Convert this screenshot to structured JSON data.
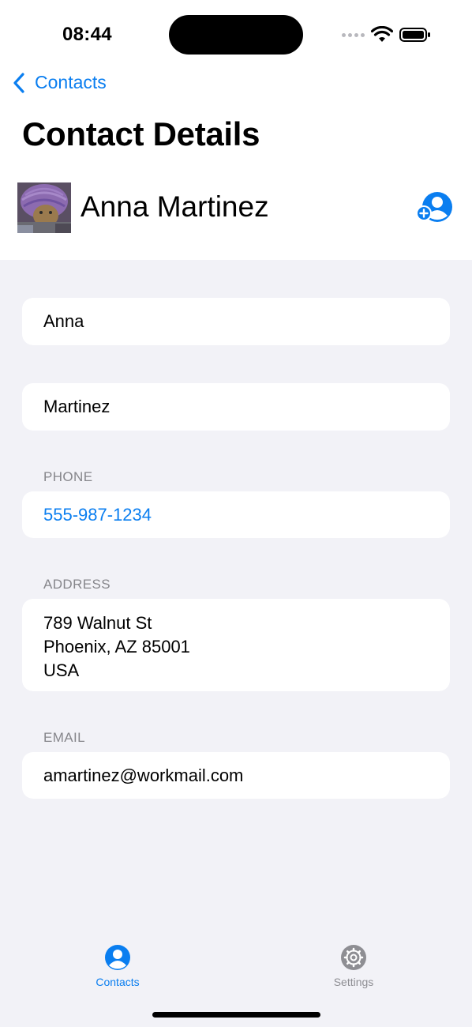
{
  "status_bar": {
    "time": "08:44"
  },
  "nav": {
    "back_label": "Contacts",
    "title": "Contact Details"
  },
  "contact": {
    "full_name": "Anna Martinez"
  },
  "fields": {
    "first_name": "Anna",
    "last_name": "Martinez",
    "phone_header": "PHONE",
    "phone": "555-987-1234",
    "address_header": "ADDRESS",
    "address_lines": [
      "789 Walnut St",
      "Phoenix, AZ 85001",
      "USA"
    ],
    "email_header": "EMAIL",
    "email": "amartinez@workmail.com"
  },
  "tab_bar": {
    "tabs": [
      {
        "label": "Contacts",
        "icon": "person-circle-icon",
        "active": true
      },
      {
        "label": "Settings",
        "icon": "gear-icon",
        "active": false
      }
    ]
  },
  "colors": {
    "accent": "#0a7ef0",
    "background": "#f2f2f7",
    "secondary_text": "#86868b"
  }
}
